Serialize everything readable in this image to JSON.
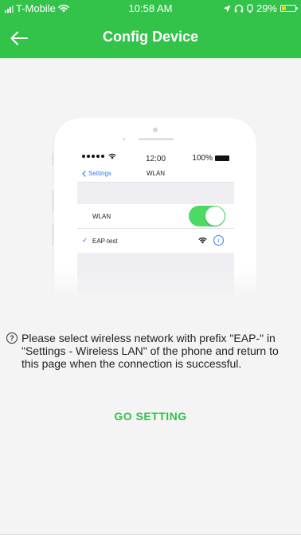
{
  "status_bar": {
    "carrier": "T-Mobile",
    "time": "10:58 AM",
    "battery": "29%",
    "battery_level": 0.29,
    "battery_color": "#f5d21b"
  },
  "nav": {
    "title": "Config Device",
    "back_icon": "arrow-left-icon"
  },
  "illustration": {
    "status_time": "12:00",
    "status_battery": "100%",
    "back_label": "Settings",
    "title": "WLAN",
    "wlan_label": "WLAN",
    "network_name": "EAP-test",
    "info_glyph": "i"
  },
  "instruction": {
    "text": "Please select wireless network with prefix \"EAP-\" in \"Settings - Wireless LAN\" of the phone and return to this page when the connection is successful.",
    "icon": "?"
  },
  "actions": {
    "go_setting": "GO SETTING"
  },
  "colors": {
    "brand_green": "#33c24a",
    "toggle_green": "#4cd964",
    "ios_blue": "#2f7cf6",
    "background": "#f4f4f4"
  }
}
